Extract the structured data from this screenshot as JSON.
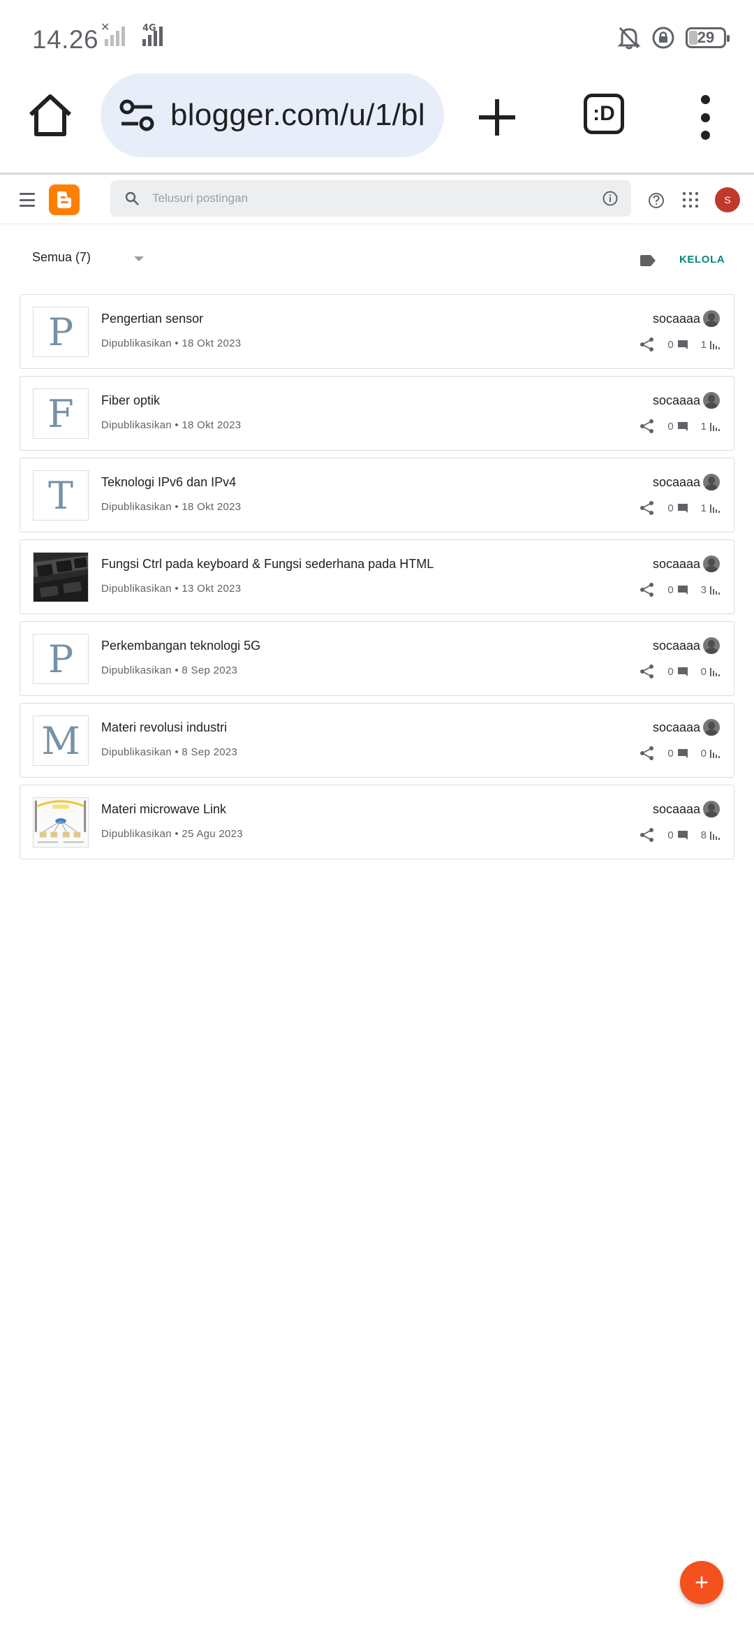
{
  "status_bar": {
    "time": "14.26",
    "network": "4G",
    "battery": "29",
    "icons": [
      "no-signal-icon",
      "signal-icon",
      "bell-off-icon",
      "rotation-lock-icon",
      "battery-icon"
    ]
  },
  "browser": {
    "url": "blogger.com/u/1/bl",
    "tabs_label": ":D",
    "icons": [
      "home-icon",
      "tune-icon",
      "plus-icon",
      "more-vert-icon"
    ]
  },
  "blogger": {
    "search_placeholder": "Telusuri postingan",
    "avatar_initial": "S",
    "brand_color": "#ff8000",
    "icons": [
      "hamburger-icon",
      "blogger-logo-icon",
      "search-icon",
      "info-icon",
      "help-icon",
      "apps-icon"
    ]
  },
  "filter": {
    "selected": "Semua (7)",
    "manage_label": "KELOLA",
    "accent_color": "#00897b"
  },
  "posts": [
    {
      "thumb": "P",
      "title": "Pengertian sensor",
      "meta": "Dipublikasikan • 18 Okt 2023",
      "author": "socaaaa",
      "comments": "0",
      "views": "1"
    },
    {
      "thumb": "F",
      "title": "Fiber optik",
      "meta": "Dipublikasikan • 18 Okt 2023",
      "author": "socaaaa",
      "comments": "0",
      "views": "1"
    },
    {
      "thumb": "T",
      "title": "Teknologi IPv6 dan IPv4",
      "meta": "Dipublikasikan • 18 Okt 2023",
      "author": "socaaaa",
      "comments": "0",
      "views": "1"
    },
    {
      "thumb": "image",
      "title": "Fungsi Ctrl pada keyboard & Fungsi sederhana pada HTML",
      "meta": "Dipublikasikan • 13 Okt 2023",
      "author": "socaaaa",
      "comments": "0",
      "views": "3"
    },
    {
      "thumb": "P",
      "title": "Perkembangan teknologi 5G",
      "meta": "Dipublikasikan • 8 Sep 2023",
      "author": "socaaaa",
      "comments": "0",
      "views": "0"
    },
    {
      "thumb": "M",
      "title": "Materi revolusi industri",
      "meta": "Dipublikasikan • 8 Sep 2023",
      "author": "socaaaa",
      "comments": "0",
      "views": "0"
    },
    {
      "thumb": "image",
      "title": "Materi microwave Link",
      "meta": "Dipublikasikan • 25 Agu 2023",
      "author": "socaaaa",
      "comments": "0",
      "views": "8"
    }
  ],
  "fab": {
    "label": "+",
    "color": "#f4511e"
  }
}
